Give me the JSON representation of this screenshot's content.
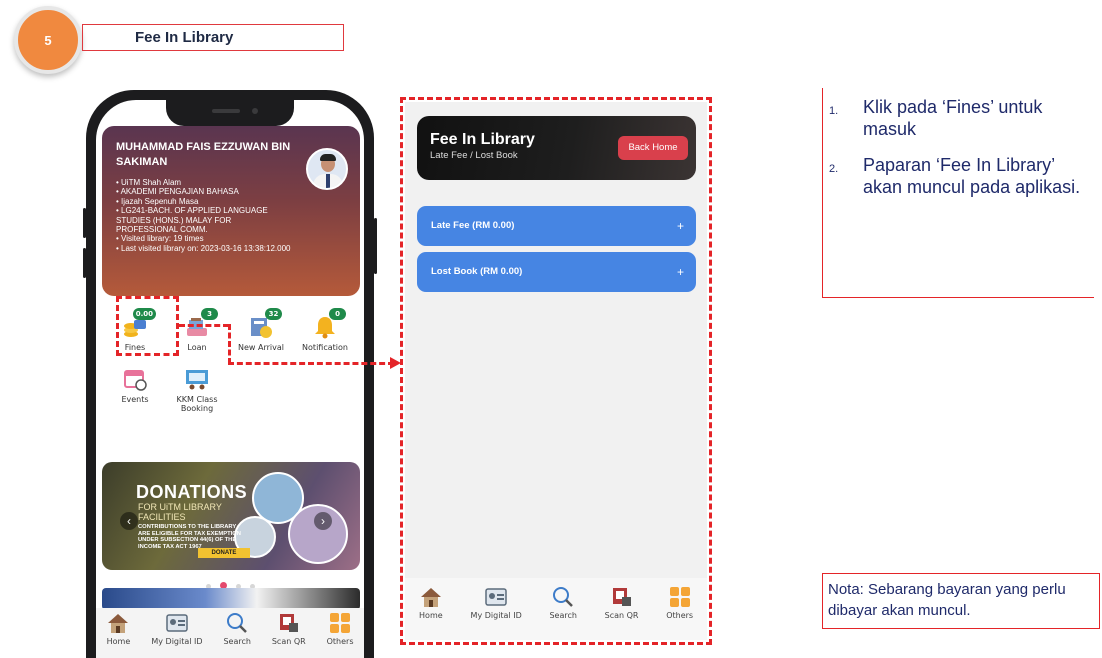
{
  "step": {
    "number": "5",
    "title": "Fee In Library"
  },
  "profile": {
    "name": "MUHAMMAD FAIS EZZUWAN BIN SAKIMAN",
    "details": [
      "UiTM Shah Alam",
      "AKADEMI PENGAJIAN BAHASA",
      "Ijazah Sepenuh Masa",
      "LG241-BACH. OF APPLIED LANGUAGE STUDIES (HONS.) MALAY FOR PROFESSIONAL COMM.",
      "Visited library: 19 times",
      "Last visited library on: 2023-03-16 13:38:12.000"
    ]
  },
  "menu": {
    "fines": {
      "label": "Fines",
      "badge": "0.00"
    },
    "loan": {
      "label": "Loan",
      "badge": "3"
    },
    "new_arrival": {
      "label": "New Arrival",
      "badge": "32"
    },
    "notification": {
      "label": "Notification",
      "badge": "0"
    },
    "events": {
      "label": "Events"
    },
    "kkm": {
      "label": "KKM Class Booking"
    }
  },
  "banner": {
    "title": "DONATIONS",
    "subtitle_1": "FOR UiTM LIBRARY",
    "subtitle_2": "FACILITIES",
    "small_1": "CONTRIBUTIONS TO THE LIBRARY",
    "small_2": "ARE ELIGIBLE FOR TAX EXEMPTION",
    "small_3": "UNDER SUBSECTION 44(6) OF THE",
    "small_4": "INCOME TAX ACT 1967",
    "button": "DONATE"
  },
  "phone_tabs": [
    {
      "label": "Home"
    },
    {
      "label": "My Digital ID"
    },
    {
      "label": "Search"
    },
    {
      "label": "Scan QR"
    },
    {
      "label": "Others"
    }
  ],
  "fee_screen": {
    "title": "Fee In Library",
    "subtitle": "Late Fee / Lost Book",
    "back_button": "Back Home",
    "late_fee": "Late Fee (RM 0.00)",
    "lost_book": "Lost Book (RM 0.00)",
    "expand_symbol": "+"
  },
  "app_tabs": [
    {
      "label": "Home"
    },
    {
      "label": "My Digital ID"
    },
    {
      "label": "Search"
    },
    {
      "label": "Scan QR"
    },
    {
      "label": "Others"
    }
  ],
  "instructions": [
    {
      "num": "1.",
      "text": "Klik pada ‘Fines’ untuk masuk"
    },
    {
      "num": "2.",
      "text": "Paparan ‘Fee In Library’ akan muncul pada aplikasi."
    }
  ],
  "note": "Nota: Sebarang bayaran yang perlu dibayar akan muncul.",
  "colors": {
    "accent_orange": "#f0893f",
    "dash_red": "#e42428",
    "accordion_blue": "#4685e3",
    "back_red": "#d9404c"
  }
}
